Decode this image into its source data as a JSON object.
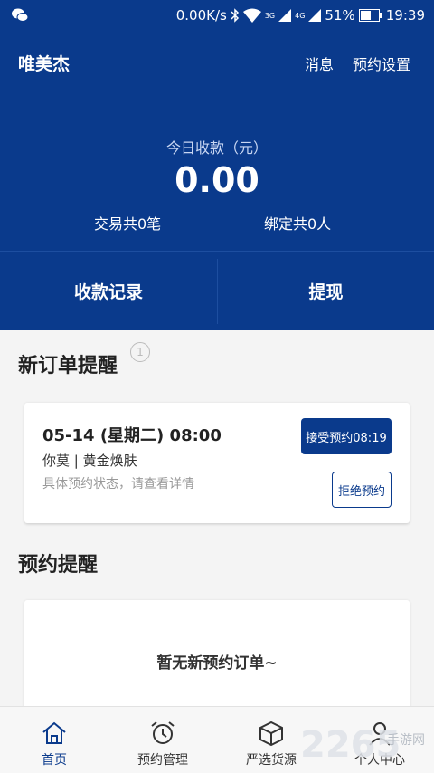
{
  "status_bar": {
    "network_speed": "0.00K/s",
    "signal_3g": "3G",
    "signal_4g": "4G",
    "battery": "51%",
    "time": "19:39",
    "icons": [
      "wechat-icon",
      "bluetooth-icon",
      "wifi-icon",
      "signal-icon",
      "battery-icon"
    ]
  },
  "header": {
    "title": "唯美杰",
    "messages_label": "消息",
    "booking_settings_label": "预约设置"
  },
  "summary": {
    "today_label": "今日收款（元）",
    "today_amount": "0.00",
    "transactions": "交易共0笔",
    "bound_users": "绑定共0人"
  },
  "actions": {
    "records_label": "收款记录",
    "withdraw_label": "提现"
  },
  "new_orders": {
    "title": "新订单提醒",
    "count": "1",
    "items": [
      {
        "datetime": "05-14 (星期二) 08:00",
        "service": "你莫 | 黄金焕肤",
        "hint": "具体预约状态，请查看详情",
        "accept_label": "接受预约08:19",
        "reject_label": "拒绝预约"
      }
    ]
  },
  "booking_reminders": {
    "title": "预约提醒",
    "empty_text": "暂无新预约订单~"
  },
  "tabbar": {
    "tabs": [
      {
        "label": "首页",
        "icon": "home-icon",
        "active": true
      },
      {
        "label": "预约管理",
        "icon": "alarm-clock-icon",
        "active": false
      },
      {
        "label": "严选货源",
        "icon": "box-icon",
        "active": false
      },
      {
        "label": "个人中心",
        "icon": "user-icon",
        "active": false
      }
    ]
  },
  "watermark": {
    "text_left": "2265",
    "text_right": "手游网"
  },
  "colors": {
    "primary": "#0a3a8c",
    "background": "#f4f4f4",
    "card": "#ffffff"
  }
}
